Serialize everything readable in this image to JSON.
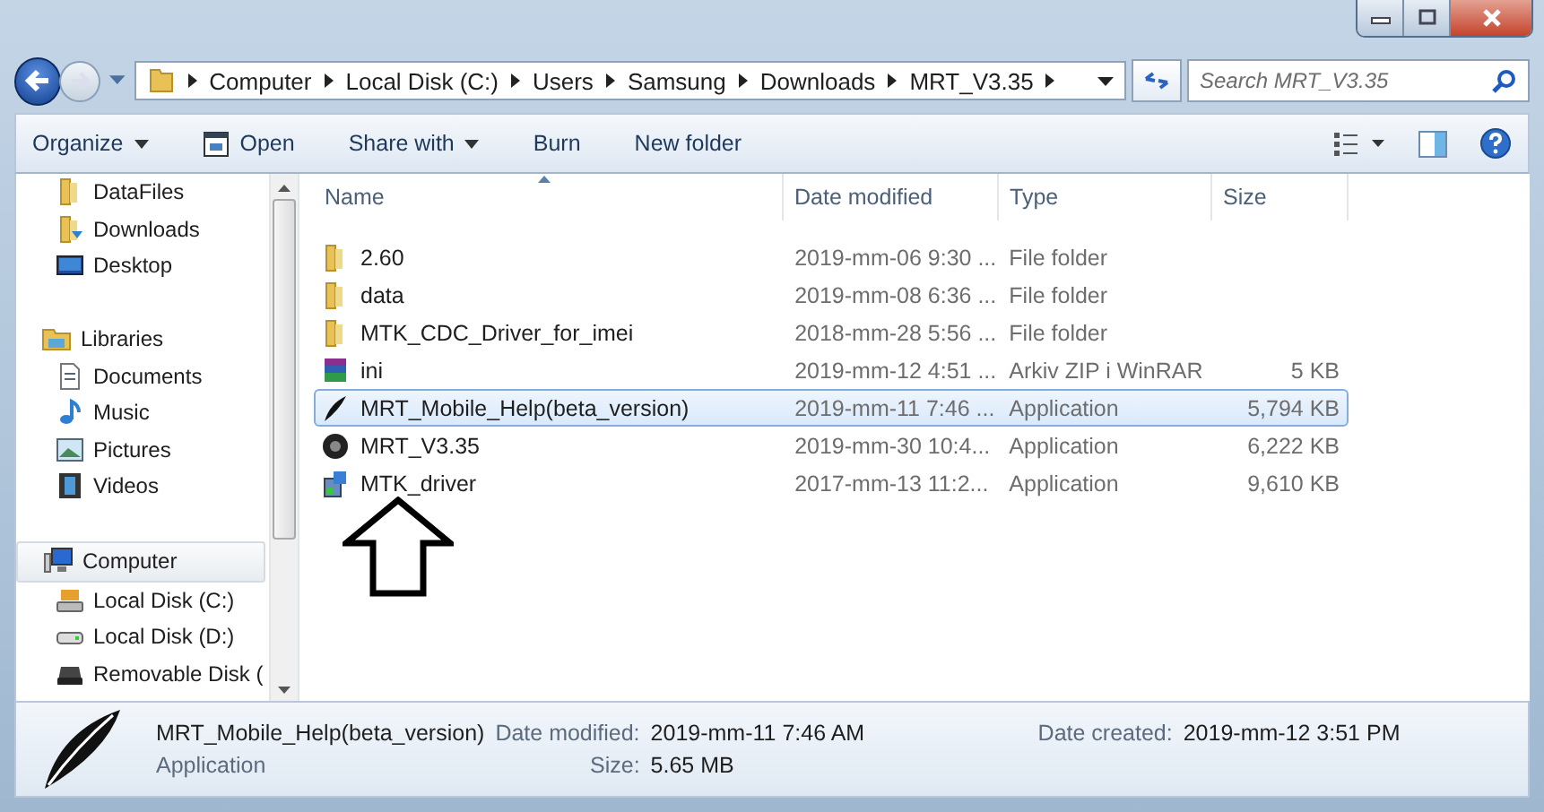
{
  "address_bar": {
    "breadcrumbs": [
      "Computer",
      "Local Disk (C:)",
      "Users",
      "Samsung",
      "Downloads",
      "MRT_V3.35"
    ]
  },
  "search": {
    "placeholder": "Search MRT_V3.35"
  },
  "toolbar": {
    "buttons": [
      {
        "label": "Organize",
        "dropdown": true
      },
      {
        "label": "Open",
        "dropdown": false
      },
      {
        "label": "Share with",
        "dropdown": true
      },
      {
        "label": "Burn",
        "dropdown": false
      },
      {
        "label": "New folder",
        "dropdown": false
      }
    ]
  },
  "nav_pane": {
    "favorites": [
      {
        "label": "DataFiles"
      },
      {
        "label": "Downloads"
      },
      {
        "label": "Desktop"
      }
    ],
    "groups": [
      {
        "label": "Libraries",
        "selected": false,
        "children": [
          {
            "label": "Documents"
          },
          {
            "label": "Music"
          },
          {
            "label": "Pictures"
          },
          {
            "label": "Videos"
          }
        ]
      },
      {
        "label": "Computer",
        "selected": true,
        "children": [
          {
            "label": "Local Disk (C:)"
          },
          {
            "label": "Local Disk (D:)"
          },
          {
            "label": "Removable Disk ("
          }
        ]
      }
    ]
  },
  "table": {
    "columns": [
      "Name",
      "Date modified",
      "Type",
      "Size"
    ],
    "rows": [
      {
        "name": "2.60",
        "date": "2019-mm-06 9:30 ...",
        "type": "File folder",
        "size": "",
        "selected": false
      },
      {
        "name": "data",
        "date": "2019-mm-08 6:36 ...",
        "type": "File folder",
        "size": "",
        "selected": false
      },
      {
        "name": "MTK_CDC_Driver_for_imei",
        "date": "2018-mm-28 5:56 ...",
        "type": "File folder",
        "size": "",
        "selected": false
      },
      {
        "name": "ini",
        "date": "2019-mm-12 4:51 ...",
        "type": "Arkiv ZIP i WinRAR",
        "size": "5 KB",
        "selected": false
      },
      {
        "name": "MRT_Mobile_Help(beta_version)",
        "date": "2019-mm-11 7:46 ...",
        "type": "Application",
        "size": "5,794 KB",
        "selected": true
      },
      {
        "name": "MRT_V3.35",
        "date": "2019-mm-30 10:4...",
        "type": "Application",
        "size": "6,222 KB",
        "selected": false
      },
      {
        "name": "MTK_driver",
        "date": "2017-mm-13 11:2...",
        "type": "Application",
        "size": "9,610 KB",
        "selected": false
      }
    ]
  },
  "details": {
    "name": "MRT_Mobile_Help(beta_version)",
    "type": "Application",
    "date_modified_label": "Date modified:",
    "date_modified": "2019-mm-11 7:46 AM",
    "date_created_label": "Date created:",
    "date_created": "2019-mm-12 3:51 PM",
    "size_label": "Size:",
    "size": "5.65 MB"
  }
}
